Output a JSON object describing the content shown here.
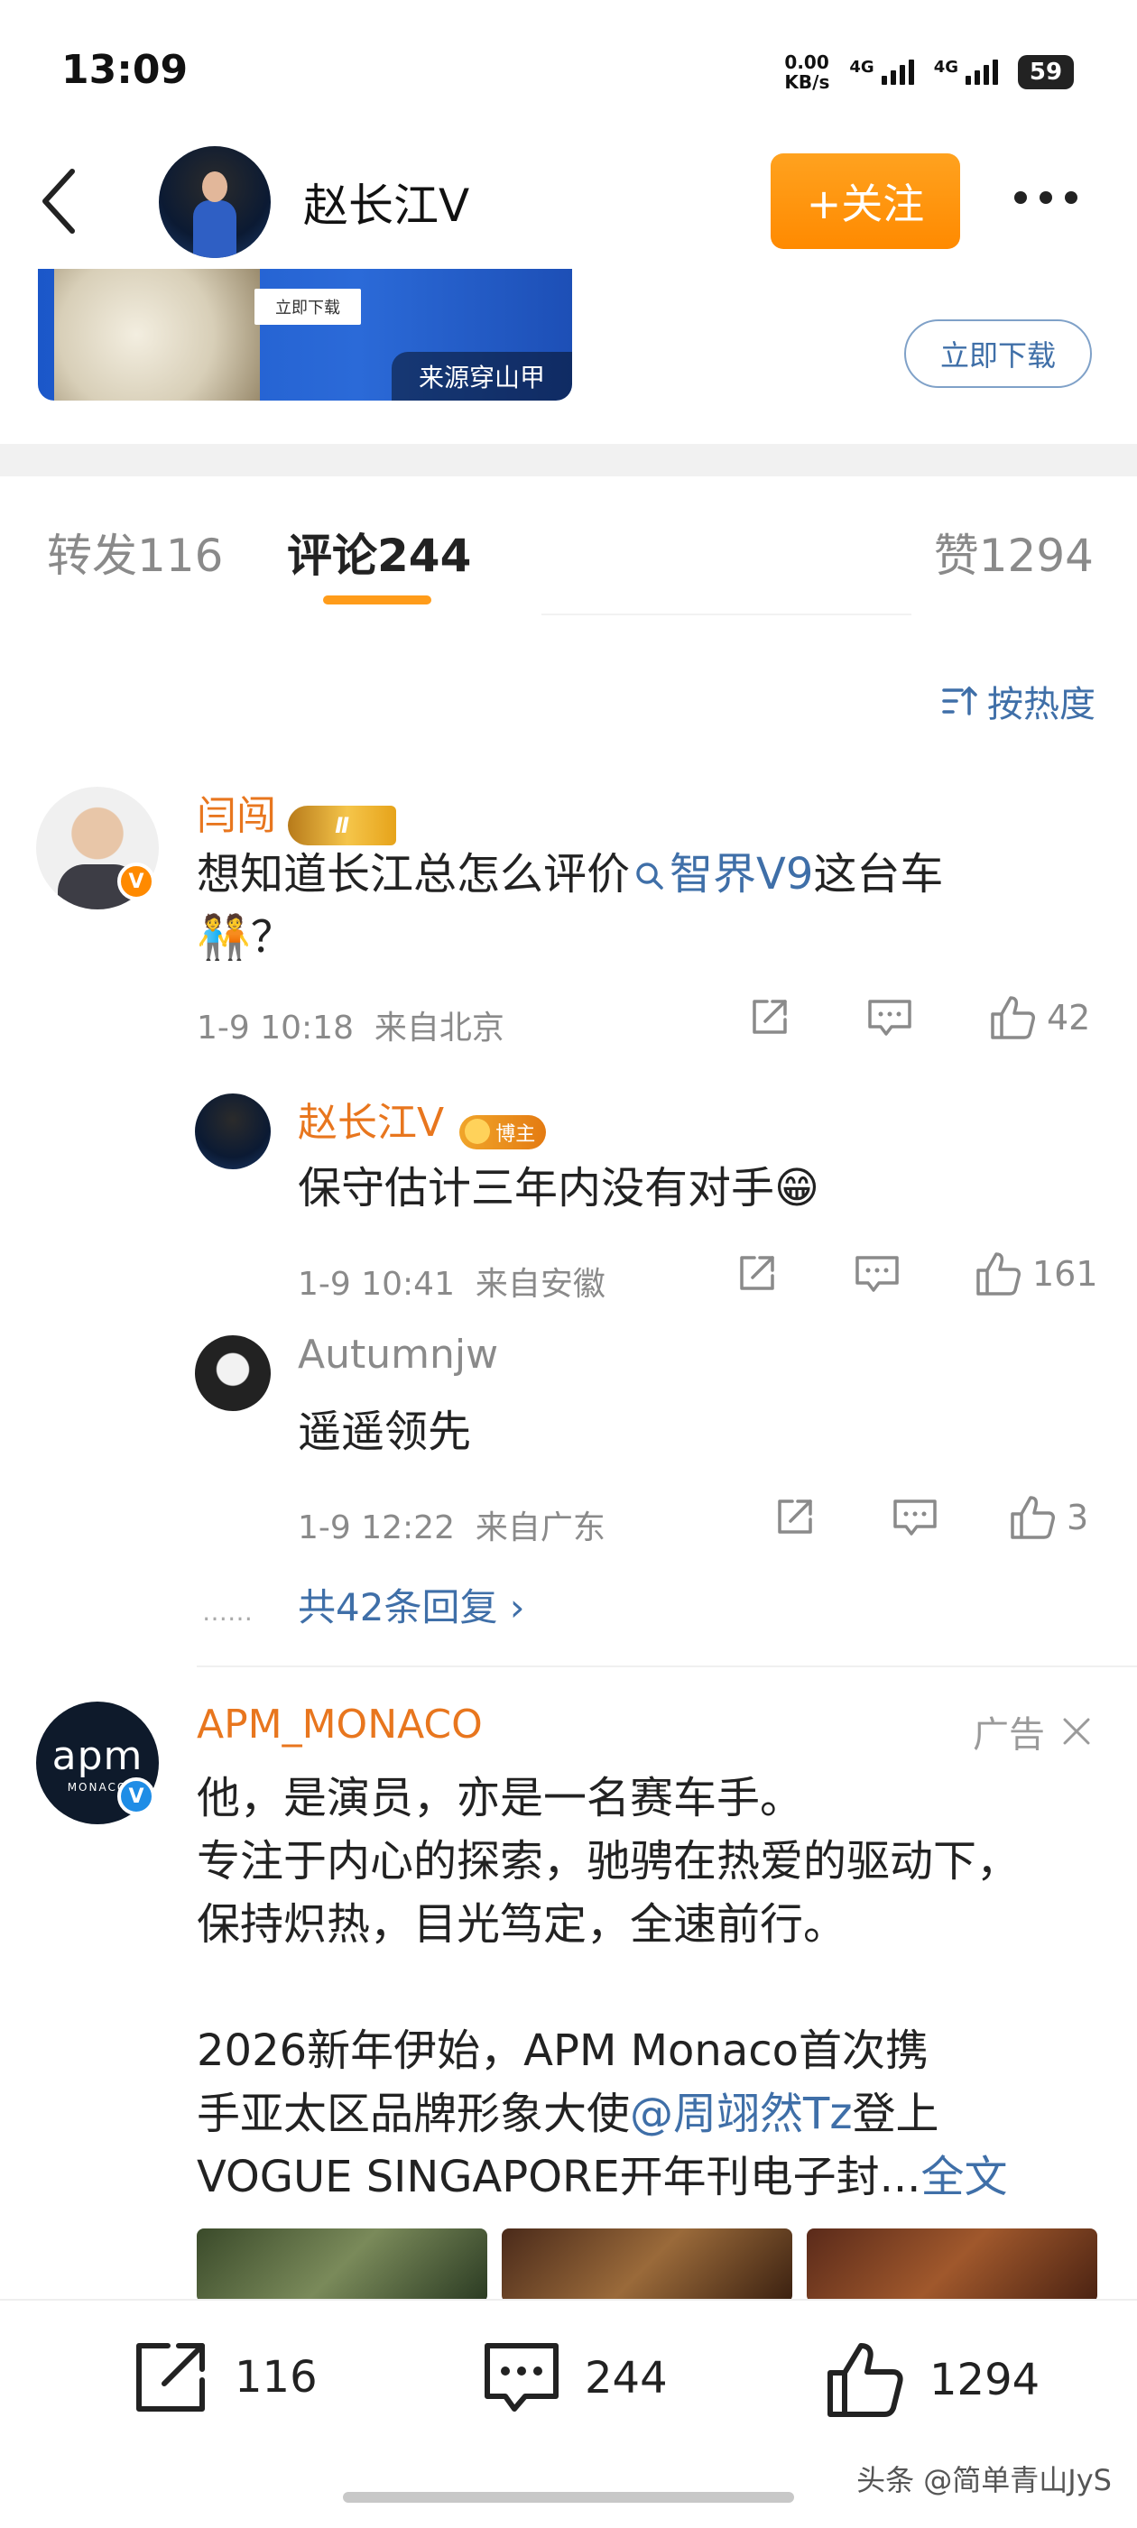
{
  "status_bar": {
    "time": "13:09",
    "net_speed": "0.00",
    "net_unit": "KB/s",
    "signal1": "4G",
    "signal2": "4G",
    "battery": "59"
  },
  "header": {
    "name": "赵长江V",
    "follow_label": "+关注"
  },
  "ad_banner": {
    "button_text": "立即下载",
    "source": "来源穿山甲",
    "download_label": "立即下载"
  },
  "tabs": [
    {
      "label": "转发",
      "count": "116"
    },
    {
      "label": "评论",
      "count": "244"
    },
    {
      "label": "赞",
      "count": "1294"
    }
  ],
  "sort_label": "按热度",
  "comments": [
    {
      "user": "闫闯",
      "level_badge": "Ⅱ",
      "text_before": "想知道长江总怎么评价",
      "topic": "智界V9",
      "text_after": "这台车",
      "text_line2": "🧑‍🤝‍🧑？",
      "time": "1-9 10:18",
      "location": "来自北京",
      "likes": "42",
      "replies": [
        {
          "user": "赵长江V",
          "badge": "博主",
          "text": "保守估计三年内没有对手😁",
          "time": "1-9 10:41",
          "location": "来自安徽",
          "likes": "161"
        },
        {
          "user": "Autumnjw",
          "text": "遥遥领先",
          "time": "1-9 12:22",
          "location": "来自广东",
          "likes": "3"
        }
      ],
      "dots": "……",
      "more_replies": "共42条回复 ›"
    }
  ],
  "ad_post": {
    "user": "APM_MONACO",
    "ad_label": "广告",
    "avatar_logo": "apm",
    "avatar_sub": "MONACO",
    "lines": [
      "他，是演员，亦是一名赛车手。",
      "专注于内心的探索，驰骋在热爱的驱动下，",
      "保持炽热，目光笃定，全速前行。"
    ],
    "para2_line1": "2026新年伊始，APM Monaco首次携",
    "para2_line2_a": "手亚太区品牌形象大使",
    "para2_mention": "@周翊然Tz",
    "para2_line2_b": "登上",
    "para2_line3": "VOGUE SINGAPORE开年刊电子封...",
    "full_text": "全文"
  },
  "bottom_bar": {
    "reposts": "116",
    "comments": "244",
    "likes": "1294"
  },
  "watermark": "头条 @简单青山JyS",
  "colors": {
    "accent_orange": "#ff8a00",
    "link_blue": "#3f6fa8",
    "username_orange": "#e8761e"
  }
}
